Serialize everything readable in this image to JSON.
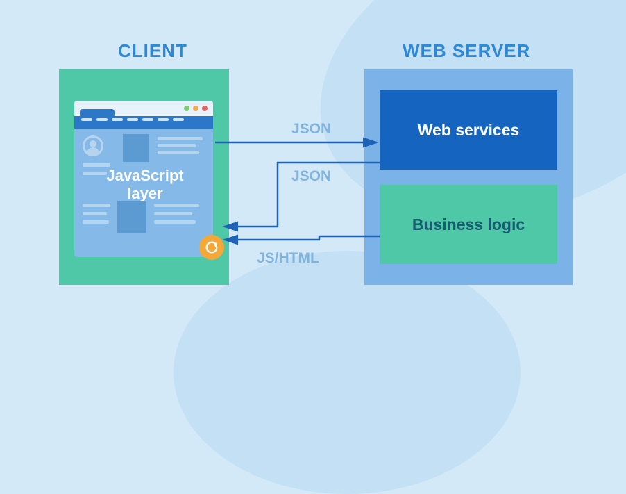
{
  "titles": {
    "client": "CLIENT",
    "server": "WEB SERVER"
  },
  "client": {
    "js_layer": "JavaScript layer"
  },
  "server": {
    "web_services": "Web services",
    "business_logic": "Business logic"
  },
  "arrows": {
    "to_server": "JSON",
    "from_web_services": "JSON",
    "from_business_logic": "JS/HTML"
  },
  "colors": {
    "teal": "#4fc8a8",
    "blue_light": "#7bb3e8",
    "blue_dark": "#1565c0",
    "orange": "#f5a83a",
    "bg": "#d4e9f7",
    "title": "#2d88d8"
  }
}
